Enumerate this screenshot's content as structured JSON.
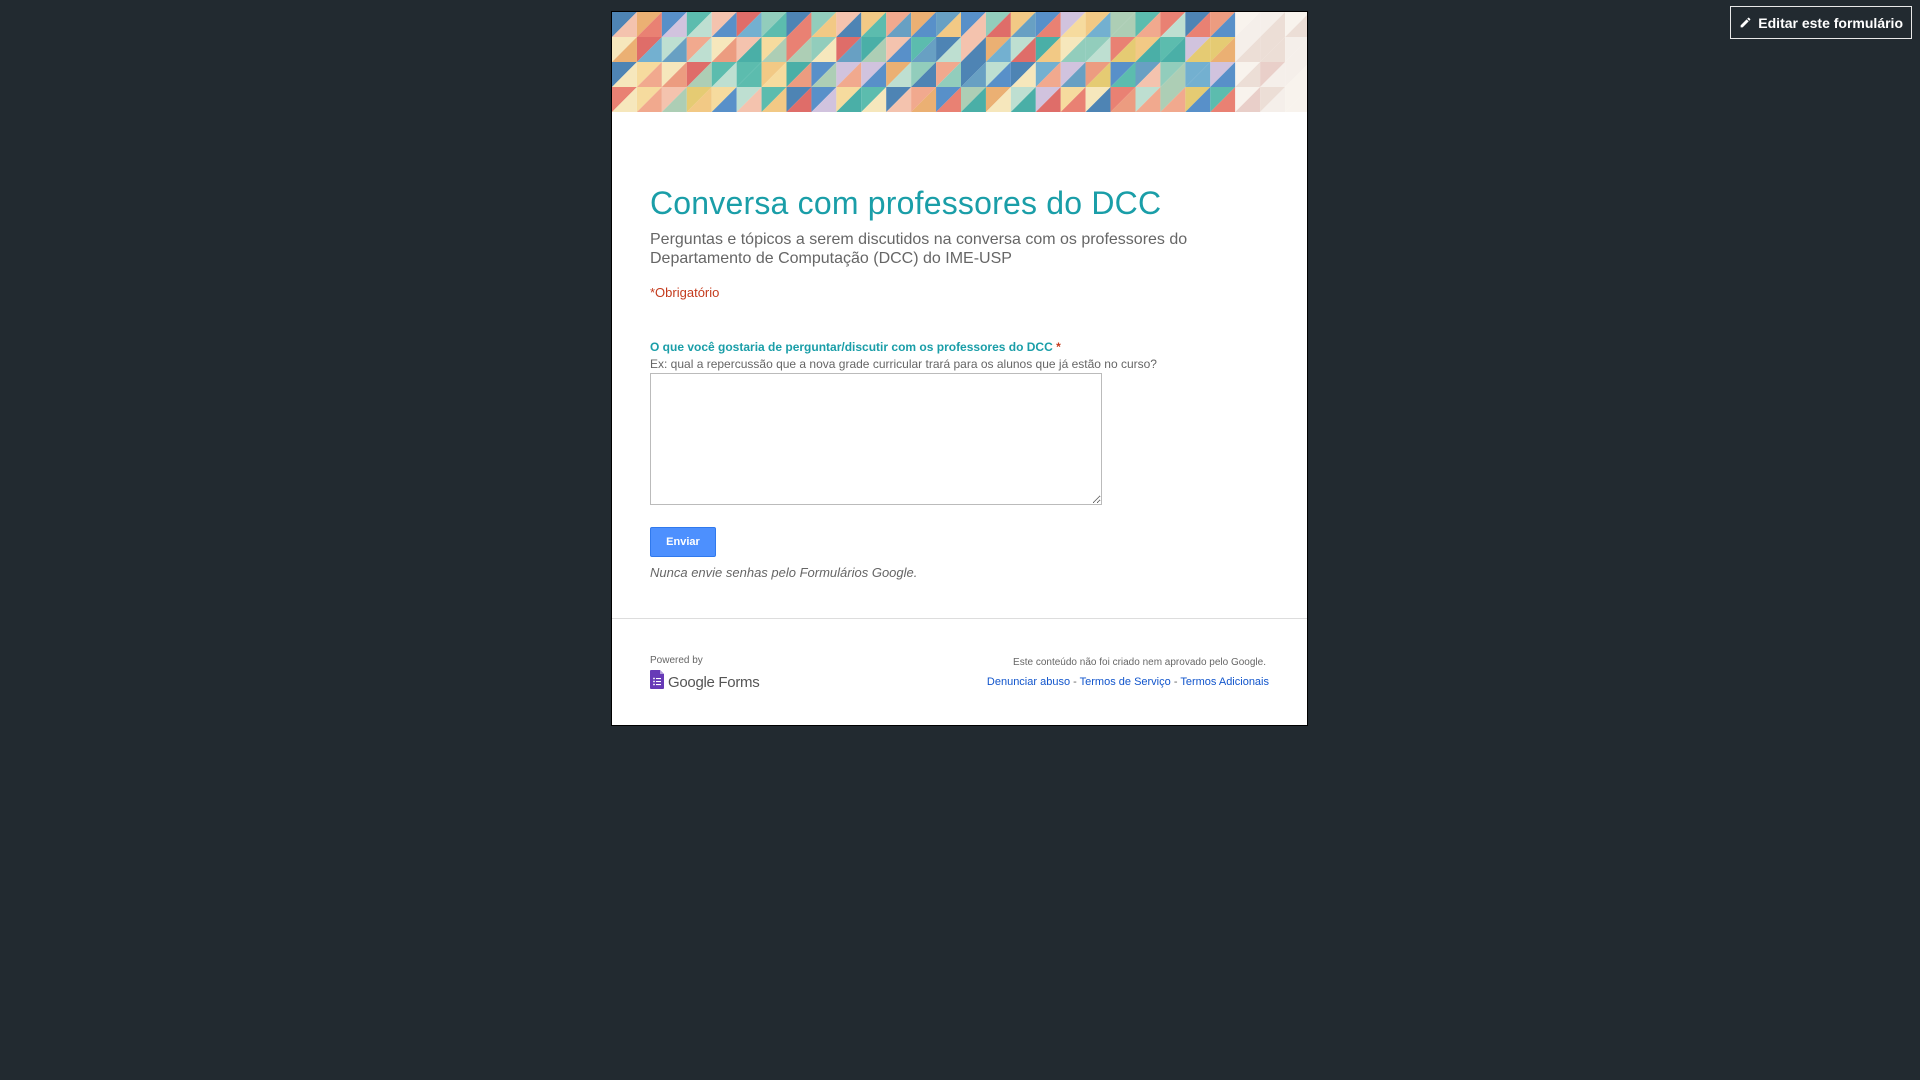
{
  "toolbar": {
    "edit_label": "Editar este formulário"
  },
  "form": {
    "title": "Conversa com professores do DCC",
    "description": "Perguntas e tópicos a serem discutidos na conversa com os professores do Departamento de Computação (DCC) do IME-USP",
    "required_note": "*Obrigatório",
    "question": {
      "title": "O que você gostaria de perguntar/discutir com os professores do DCC",
      "required_mark": "*",
      "help_text": "Ex: qual a repercussão que a nova grade curricular trará para os alunos que já estão no curso?",
      "value": ""
    },
    "submit_label": "Enviar",
    "password_warning": "Nunca envie senhas pelo Formulários Google."
  },
  "footer": {
    "powered_by": "Powered by",
    "brand": "Google Forms",
    "disclaimer": "Este conteúdo não foi criado nem aprovado pelo Google.",
    "links": {
      "report": "Denunciar abuso",
      "separator": "-",
      "terms": "Termos de Serviço",
      "additional": "Termos Adicionais"
    }
  },
  "icons": {
    "edit": "pencil-icon",
    "brand": "google-forms-icon"
  },
  "colors": {
    "background": "#222a30",
    "title": "#1a9ea8",
    "required": "#c43b1d",
    "submit": "#4d90fe",
    "link": "#1155cc",
    "brand_icon": "#673ab7"
  }
}
